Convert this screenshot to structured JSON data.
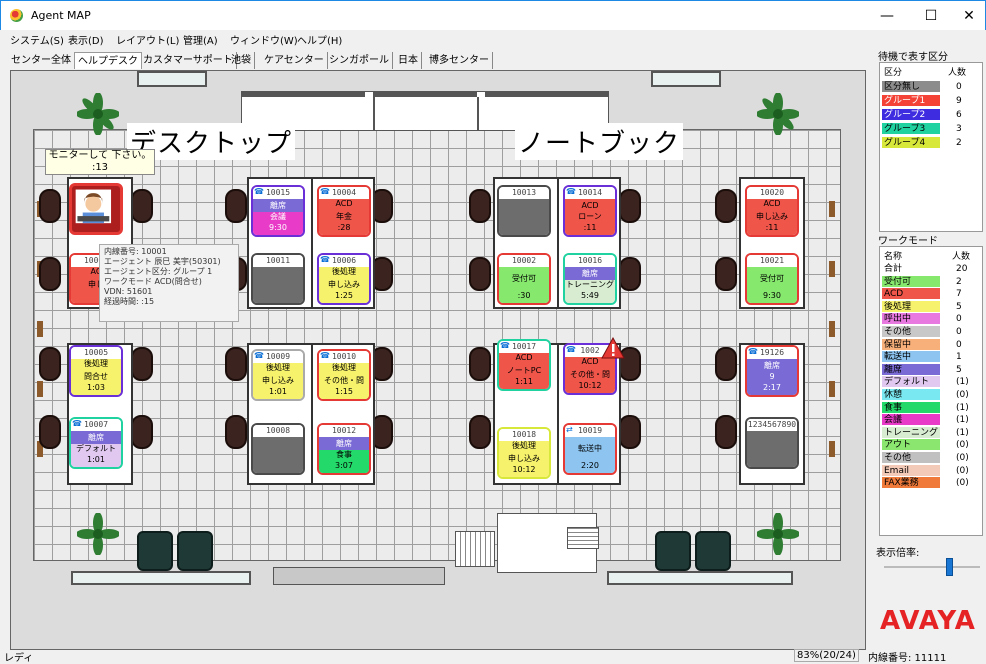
{
  "window": {
    "title": "Agent MAP",
    "minimize": "—",
    "maximize": "☐",
    "close": "✕"
  },
  "menu": [
    "システム(S)",
    "表示(D)",
    "レイアウト(L)",
    "管理(A)",
    "ウィンドウ(W)",
    "ヘルプ(H)"
  ],
  "tabs": [
    "センター全体",
    "ヘルプデスク",
    "カスタマーサポート",
    "池袋",
    "ケアセンター",
    "シンガポール",
    "日本",
    "博多センター"
  ],
  "active_tab": "ヘルプデスク",
  "zones": {
    "left": "デスクトップ",
    "right": "ノートブック"
  },
  "bubble": {
    "line1": "モニターして 下さい。",
    "line2": ":13"
  },
  "tooltip": [
    "内線番号: 10001",
    "エージェント 辰巳 美宇(50301)",
    "エージェント区分: グループ 1",
    "ワークモード ACD(問合せ)",
    "VDN: 51601",
    "経過時間:       :15"
  ],
  "cards": {
    "c10015": {
      "num": "10015",
      "band": "離席",
      "line1": "会議",
      "line2": "9:30"
    },
    "c10004": {
      "num": "10004",
      "band": "",
      "line1": "ACD",
      "line2": "年金",
      "line3": ":28"
    },
    "c10013": {
      "num": "10013"
    },
    "c10014": {
      "num": "10014",
      "band": "ACD",
      "line1": "ローン",
      "line2": ":11"
    },
    "c10020": {
      "num": "10020",
      "line1": "ACD",
      "line2": "申し込み",
      "line3": ":11"
    },
    "c10003": {
      "num": "10003",
      "line1": "AC",
      "line2": "申し"
    },
    "c10011": {
      "num": "10011"
    },
    "c10006": {
      "num": "10006",
      "line1": "後処理",
      "line2": "申し込み",
      "line3": "1:25"
    },
    "c10002": {
      "num": "10002",
      "line1": "受付可",
      "line2": ":30"
    },
    "c10016": {
      "num": "10016",
      "band": "離席",
      "line1": "トレーニング",
      "line2": "5:49"
    },
    "c10021": {
      "num": "10021",
      "line1": "受付可",
      "line2": "9:30"
    },
    "c10005": {
      "num": "10005",
      "line1": "後処理",
      "line2": "問合せ",
      "line3": "1:03"
    },
    "c10009": {
      "num": "10009",
      "line1": "後処理",
      "line2": "申し込み",
      "line3": "1:01"
    },
    "c10010": {
      "num": "10010",
      "line1": "後処理",
      "line2": "その他・問",
      "line3": "1:15"
    },
    "c10017": {
      "num": "10017",
      "line1": "ACD",
      "line2": "ノートPC",
      "line3": "1:11"
    },
    "c10022": {
      "num": "1002",
      "line1": "ACD",
      "line2": "その他・問",
      "line3": "10:12"
    },
    "c19126": {
      "num": "19126",
      "band": "離席",
      "line1": "9",
      "line2": "2:17"
    },
    "c10007": {
      "num": "10007",
      "band": "離席",
      "line1": "デフォルト",
      "line2": "1:01"
    },
    "c10008": {
      "num": "10008"
    },
    "c10012": {
      "num": "10012",
      "line1": "離席",
      "line2": "食事",
      "line3": "3:07"
    },
    "c10018": {
      "num": "10018",
      "line1": "後処理",
      "line2": "申し込み",
      "line3": "10:12"
    },
    "c10019": {
      "num": "10019",
      "line1": "転送中",
      "line2": "2:20"
    },
    "c1234567890": {
      "num": "1234567890"
    }
  },
  "panel": {
    "groups_title": "待機で表す区分",
    "groups_headers": [
      "区分",
      "人数"
    ],
    "groups": [
      {
        "name": "区分無し",
        "count": "0",
        "color": "#8c8c8c"
      },
      {
        "name": "グループ1",
        "count": "9",
        "color": "#f44336"
      },
      {
        "name": "グループ2",
        "count": "6",
        "color": "#3d2ce0"
      },
      {
        "name": "グループ3",
        "count": "3",
        "color": "#20d2a0"
      },
      {
        "name": "グループ4",
        "count": "2",
        "color": "#d8e83a"
      }
    ],
    "modes_title": "ワークモード",
    "modes_headers": [
      "名称",
      "人数"
    ],
    "modes": [
      {
        "name": "合計",
        "count": "20",
        "color": "#ffffff"
      },
      {
        "name": "受付可",
        "count": "2",
        "color": "#87e86e"
      },
      {
        "name": "ACD",
        "count": "7",
        "color": "#f0554a"
      },
      {
        "name": "後処理",
        "count": "5",
        "color": "#f7f26b"
      },
      {
        "name": "呼出中",
        "count": "0",
        "color": "#e879e0"
      },
      {
        "name": "その他",
        "count": "0",
        "color": "#c8c8c8"
      },
      {
        "name": "保留中",
        "count": "0",
        "color": "#f7b07a"
      },
      {
        "name": "転送中",
        "count": "1",
        "color": "#8dc5f0"
      },
      {
        "name": "離席",
        "count": "5",
        "color": "#7a6ad6"
      },
      {
        "name": "デフォルト",
        "count": "(1)",
        "color": "#e0c8f0"
      },
      {
        "name": "休憩",
        "count": "(0)",
        "color": "#7ae8f0"
      },
      {
        "name": "食事",
        "count": "(1)",
        "color": "#23d96a"
      },
      {
        "name": "会議",
        "count": "(1)",
        "color": "#e83cc8"
      },
      {
        "name": "トレーニング",
        "count": "(1)",
        "color": "#d7ecd0"
      },
      {
        "name": "アウト",
        "count": "(0)",
        "color": "#8ae66e"
      },
      {
        "name": "その他",
        "count": "(0)",
        "color": "#c0c0c0"
      },
      {
        "name": "Email",
        "count": "(0)",
        "color": "#f3c9b8"
      },
      {
        "name": "FAX業務",
        "count": "(0)",
        "color": "#f07a3a"
      }
    ],
    "zoom_label": "表示倍率:",
    "zoom_level": 0.7,
    "brand": "AVAYA"
  },
  "status": {
    "left": "レディ",
    "zoom": "83%(20/24)",
    "ext": "内線番号: 11111"
  }
}
